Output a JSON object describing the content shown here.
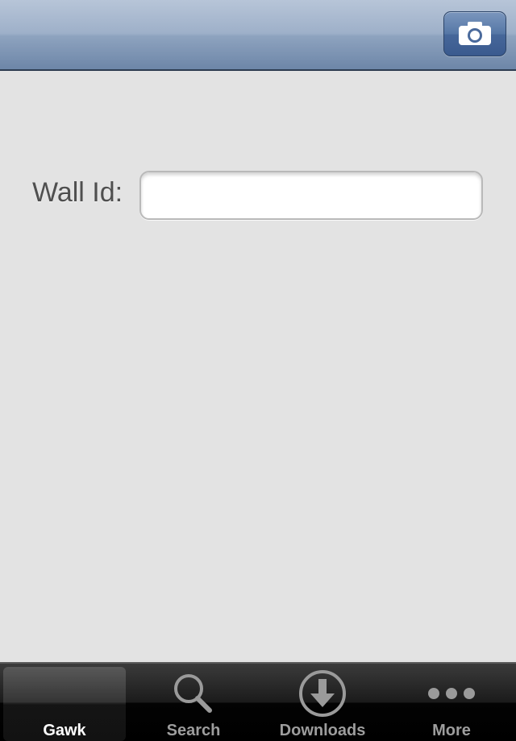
{
  "navbar": {
    "right_button_icon": "camera-icon"
  },
  "form": {
    "wall_id_label": "Wall Id:",
    "wall_id_value": "",
    "wall_id_placeholder": ""
  },
  "tabbar": {
    "selected": "Gawk",
    "tabs": [
      {
        "label": "Gawk",
        "icon": "none"
      },
      {
        "label": "Search",
        "icon": "magnifier-icon"
      },
      {
        "label": "Downloads",
        "icon": "download-arrow-icon"
      },
      {
        "label": "More",
        "icon": "ellipsis-icon"
      }
    ]
  },
  "colors": {
    "navbar": "#8ea3bf",
    "background": "#e3e3e3",
    "tabbar": "#1b1b1b",
    "tab_selected_label": "#ffffff",
    "tab_label": "#9d9d9d"
  }
}
